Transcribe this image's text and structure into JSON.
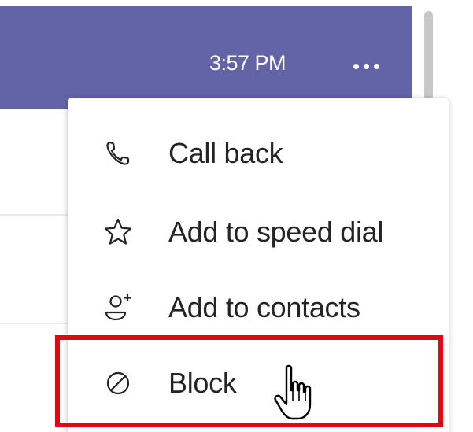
{
  "header": {
    "time": "3:57 PM",
    "more_icon": "more-horizontal-icon"
  },
  "menu": {
    "items": [
      {
        "label": "Call back",
        "icon": "phone-icon"
      },
      {
        "label": "Add to speed dial",
        "icon": "star-icon"
      },
      {
        "label": "Add to contacts",
        "icon": "add-contact-icon"
      },
      {
        "label": "Block",
        "icon": "block-icon"
      }
    ]
  },
  "colors": {
    "header_bg": "#6264a7",
    "highlight": "#e3070f",
    "text": "#252424"
  }
}
